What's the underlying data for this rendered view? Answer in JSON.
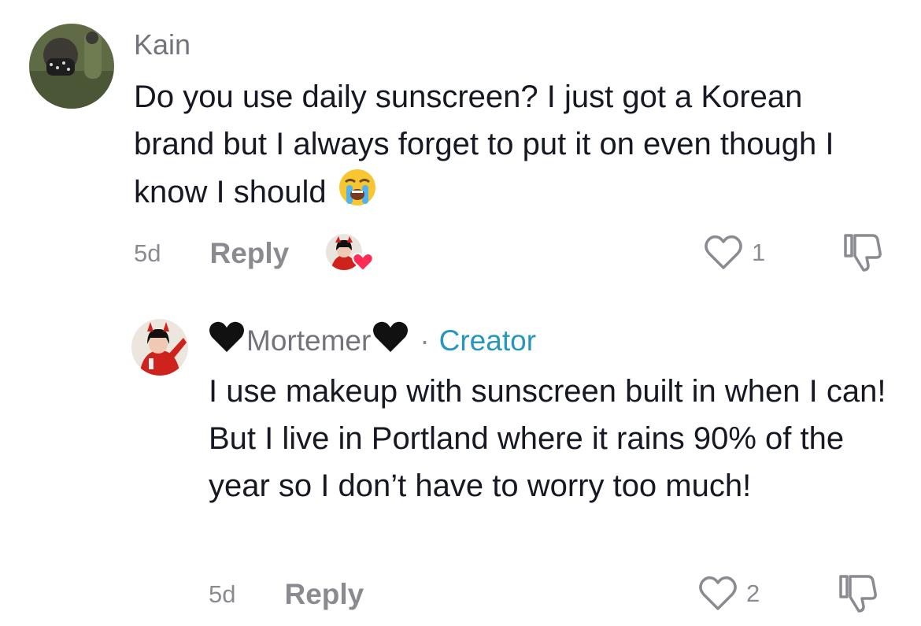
{
  "comments": [
    {
      "username": "Kain",
      "text": "Do you use daily sunscreen? I just got a Korean brand but I always forget to put it on even though I know I should",
      "text_emoji": "loudly-crying-face",
      "time": "5d",
      "reply_label": "Reply",
      "likes": "1",
      "creator_liked": true
    }
  ],
  "reply": {
    "username": "Mortemer",
    "name_emoji": "black-heart",
    "separator": "·",
    "badge": "Creator",
    "text": "I use makeup with sunscreen built in when I can! But I live in Portland where it rains 90% of the year so I don’t have to worry too much!",
    "time": "5d",
    "reply_label": "Reply",
    "likes": "2"
  },
  "colors": {
    "text": "#161823",
    "secondary": "#8a8b91",
    "creator": "#2596be",
    "heart_badge": "#fe2c55"
  }
}
